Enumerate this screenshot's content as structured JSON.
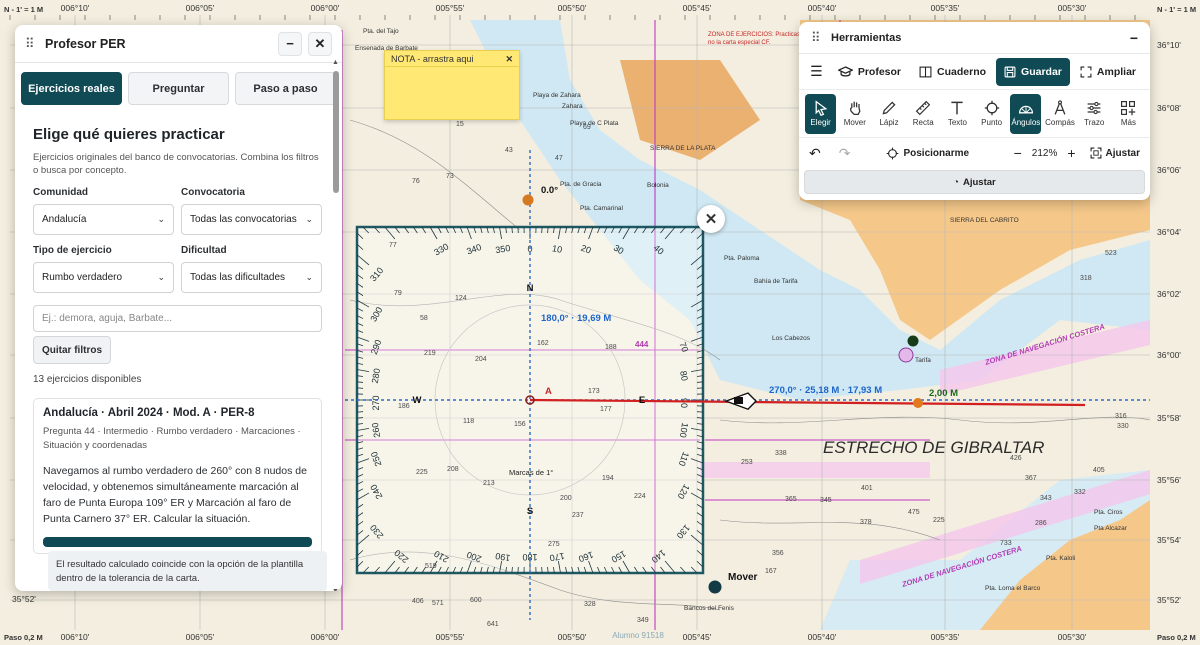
{
  "left_panel": {
    "title": "Profesor PER",
    "minimize": "−",
    "close": "✕",
    "tabs": [
      "Ejercicios reales",
      "Preguntar",
      "Paso a paso"
    ],
    "heading": "Elige qué quieres practicar",
    "description": "Ejercicios originales del banco de convocatorias. Combina los filtros o busca por concepto.",
    "filters": {
      "community_label": "Comunidad",
      "community_value": "Andalucía",
      "call_label": "Convocatoria",
      "call_value": "Todas las convocatorias",
      "type_label": "Tipo de ejercicio",
      "type_value": "Rumbo verdadero",
      "difficulty_label": "Dificultad",
      "difficulty_value": "Todas las dificultades",
      "search_placeholder": "Ej.: demora, aguja, Barbate...",
      "clear_label": "Quitar filtros"
    },
    "count": "13 ejercicios disponibles",
    "card": {
      "title": "Andalucía · Abril 2024 · Mod. A · PER-8",
      "meta": "Pregunta 44 · Intermedio · Rumbo verdadero · Marcaciones · Situación y coordenadas",
      "text": "Navegamos al rumbo verdadero de 260° con 8 nudos de velocidad, y obtenemos simultáneamente marcación al faro de Punta Europa 109° ER y Marcación al faro de Punta Carnero 37° ER. Calcular la situación."
    },
    "toast": "El resultado calculado coincide con la opción de la plantilla dentro de la tolerancia de la carta."
  },
  "note": {
    "title": "NOTA - arrastra aqui",
    "close": "✕"
  },
  "tools_panel": {
    "title": "Herramientas",
    "minimize": "−",
    "modes": [
      {
        "label": "Profesor",
        "icon": "graduation-cap-icon"
      },
      {
        "label": "Cuaderno",
        "icon": "book-icon"
      },
      {
        "label": "Guardar",
        "icon": "save-icon"
      },
      {
        "label": "Ampliar",
        "icon": "expand-icon"
      }
    ],
    "tools": [
      "Elegir",
      "Mover",
      "Lápiz",
      "Recta",
      "Texto",
      "Punto",
      "Ángulos",
      "Compás",
      "Trazo",
      "Más"
    ],
    "locate_label": "Posicionarme",
    "zoom": "212%",
    "fit_label": "Ajustar",
    "adjust_button": "Ajustar"
  },
  "chart": {
    "top_left": "N - 1' = 1 M",
    "top_right": "N - 1' = 1 M",
    "bottom_left": "Paso 0,2 M",
    "bottom_right": "Paso 0,2 M",
    "lon_labels": [
      "006°10'",
      "006°05'",
      "006°00'",
      "005°55'",
      "005°50'",
      "005°45'",
      "005°40'",
      "005°35'",
      "005°30'"
    ],
    "lat_right": [
      "36°10'",
      "36°08'",
      "36°06'",
      "36°04'",
      "36°02'",
      "36°00'",
      "35°58'",
      "35°56'",
      "35°54'",
      "35°52'"
    ],
    "lat_left": [
      "35°52'"
    ],
    "watermark": "Alumno 91518",
    "strait": "ESTRECHO DE GIBRALTAR",
    "zone_nav": "ZONA DE NAVEGACIÓN COSTERA",
    "exercise_zone": "ZONA DE EJERCICIOS: Practicas las",
    "exercise_zone2": "no la carta especial CF.",
    "bearing_label": "180,0° · 19,69 M",
    "course_label": "270,0° · 25,18 M · 17,93 M",
    "distance_label": "2,00 M",
    "zero_label": "0.0°",
    "point_a": "A",
    "protractor_n": "N",
    "protractor_s": "S",
    "protractor_e": "E",
    "protractor_w": "W",
    "marks_label": "Marcas de 1°",
    "mover_label": "Mover",
    "value_444": "444",
    "place_names": [
      "Pta. del Tajo",
      "Ensenada de Barbate",
      "Barbate",
      "Playa de Zahara",
      "Zahara",
      "Playa de C Plata",
      "SIERRA DE LA PLATA",
      "Pta. de Gracia",
      "Bolonia",
      "Pta. Camarinal",
      "Pta. Paloma",
      "Bahía de Tarifa",
      "Los Cabezos",
      "Tarifa",
      "SIERRA DEL CABRITO",
      "Pta. Ciros",
      "Pta. Kaloli",
      "Pta. Loma el Barco",
      "Bancos del Fenis",
      "Pta Alcazar"
    ],
    "tick_labels": [
      "330",
      "340",
      "350",
      "0",
      "10",
      "20",
      "30",
      "40",
      "310",
      "300",
      "290",
      "280",
      "270",
      "260",
      "250",
      "240",
      "230",
      "70",
      "80",
      "90",
      "100",
      "110",
      "120",
      "130",
      "200",
      "190",
      "180",
      "170",
      "160",
      "150",
      "140",
      "210",
      "220"
    ],
    "soundings": [
      "76",
      "73",
      "15",
      "43",
      "47",
      "69",
      "77",
      "79",
      "58",
      "124",
      "162",
      "188",
      "219",
      "204",
      "186",
      "156",
      "173",
      "177",
      "118",
      "225",
      "208",
      "194",
      "213",
      "224",
      "338",
      "253",
      "345",
      "365",
      "401",
      "475",
      "378",
      "405",
      "316",
      "330",
      "332",
      "426",
      "367",
      "343",
      "356",
      "167",
      "200",
      "237",
      "275",
      "328",
      "349",
      "406",
      "519",
      "571",
      "600",
      "641",
      "733",
      "286",
      "523",
      "318",
      "225"
    ]
  }
}
